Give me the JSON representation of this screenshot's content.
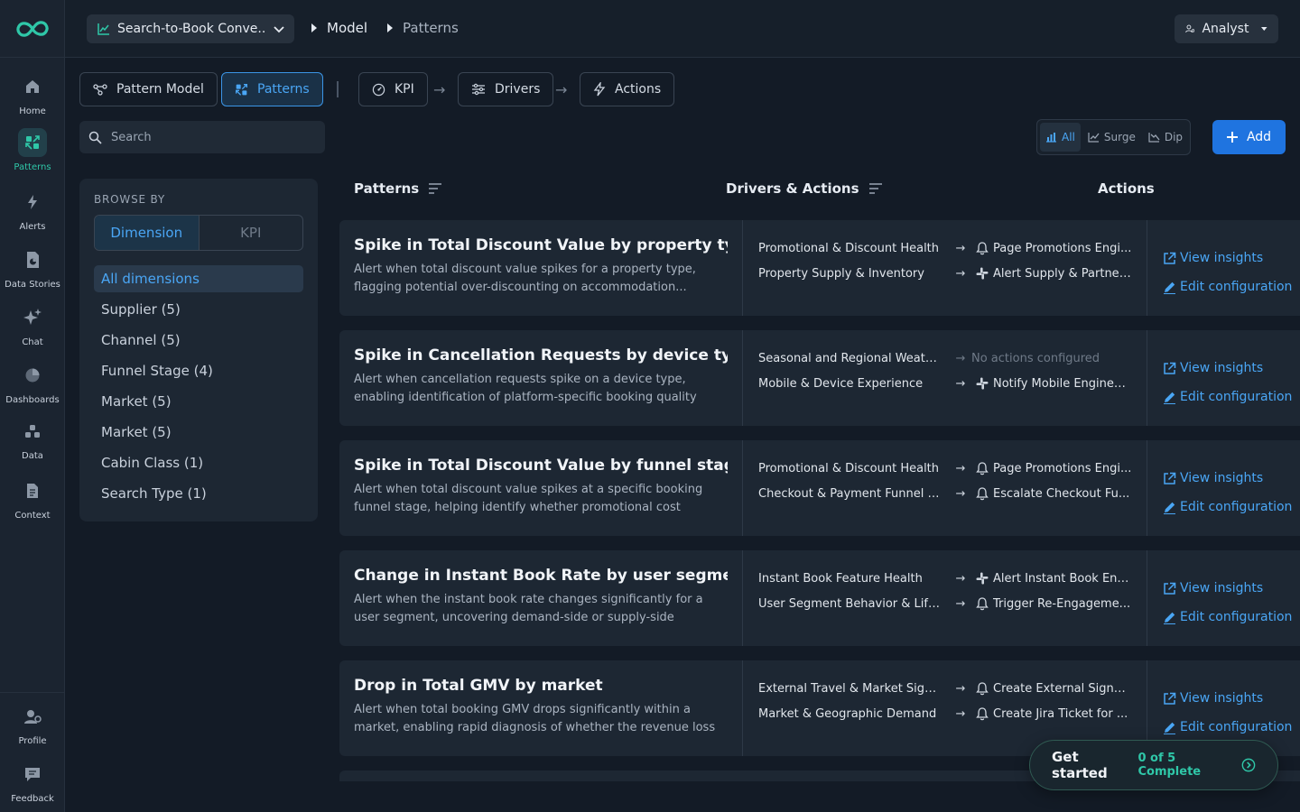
{
  "nav": {
    "items": [
      {
        "label": "Home",
        "icon": "home-icon"
      },
      {
        "label": "Patterns",
        "icon": "patterns-icon"
      },
      {
        "label": "Alerts",
        "icon": "bolt-icon"
      },
      {
        "label": "Data Stories",
        "icon": "data-stories-icon"
      },
      {
        "label": "Chat",
        "icon": "sparkle-icon"
      },
      {
        "label": "Dashboards",
        "icon": "pie-chart-icon"
      },
      {
        "label": "Data",
        "icon": "data-icon"
      },
      {
        "label": "Context",
        "icon": "document-icon"
      }
    ],
    "profile_label": "Profile",
    "feedback_label": "Feedback"
  },
  "header": {
    "model_select": "Search-to-Book Conve...",
    "breadcrumb": [
      "Model",
      "Patterns"
    ],
    "role": "Analyst"
  },
  "tabs": {
    "pattern_model": "Pattern Model",
    "patterns": "Patterns",
    "kpi": "KPI",
    "drivers": "Drivers",
    "actions": "Actions"
  },
  "search": {
    "placeholder": "Search"
  },
  "browse": {
    "title": "BROWSE BY",
    "toggle": [
      "Dimension",
      "KPI"
    ],
    "items": [
      "All dimensions",
      "Supplier (5)",
      "Channel (5)",
      "Funnel Stage (4)",
      "Market (5)",
      "Market (5)",
      "Cabin Class (1)",
      "Search Type (1)"
    ]
  },
  "filters": [
    "All",
    "Surge",
    "Dip"
  ],
  "add_label": "Add",
  "table": {
    "headers": [
      "Patterns",
      "Drivers & Actions",
      "Actions"
    ],
    "view_label": "View insights",
    "edit_label": "Edit configuration",
    "rows": [
      {
        "title": "Spike in Total Discount Value by property type",
        "desc": "Alert when total discount value spikes for a property type, flagging potential over-discounting on accommodation...",
        "drivers": [
          {
            "name": "Promotional & Discount Health",
            "icon": "bell-icon",
            "action": "Page Promotions Engi..."
          },
          {
            "name": "Property Supply & Inventory",
            "icon": "slack-icon",
            "action": "Alert Supply & Partner..."
          }
        ]
      },
      {
        "title": "Spike in Cancellation Requests by device type",
        "desc": "Alert when cancellation requests spike on a device type, enabling identification of platform-specific booking quality issues.",
        "drivers": [
          {
            "name": "Seasonal and Regional Weath...",
            "icon": "",
            "action": "No actions configured"
          },
          {
            "name": "Mobile & Device Experience",
            "icon": "slack-icon",
            "action": "Notify Mobile Enginee..."
          }
        ]
      },
      {
        "title": "Spike in Total Discount Value by funnel stage",
        "desc": "Alert when total discount value spikes at a specific booking funnel stage, helping identify whether promotional cost increases...",
        "drivers": [
          {
            "name": "Promotional & Discount Health",
            "icon": "bell-icon",
            "action": "Page Promotions Engi..."
          },
          {
            "name": "Checkout & Payment Funnel H...",
            "icon": "bell-icon",
            "action": "Escalate Checkout Fu..."
          }
        ]
      },
      {
        "title": "Change in Instant Book Rate by user segment",
        "desc": "Alert when the instant book rate changes significantly for a user segment, uncovering demand-side or supply-side mismatches...",
        "drivers": [
          {
            "name": "Instant Book Feature Health",
            "icon": "slack-icon",
            "action": "Alert Instant Book Eng..."
          },
          {
            "name": "User Segment Behavior & Life...",
            "icon": "bell-icon",
            "action": "Trigger Re-Engageme..."
          }
        ]
      },
      {
        "title": "Drop in Total GMV by market",
        "desc": "Alert when total booking GMV drops significantly within a market, enabling rapid diagnosis of whether the revenue loss stems fro...",
        "drivers": [
          {
            "name": "External Travel & Market Signals",
            "icon": "bell-icon",
            "action": "Create External Signal..."
          },
          {
            "name": "Market & Geographic Demand",
            "icon": "bell-icon",
            "action": "Create Jira Ticket for ..."
          }
        ]
      }
    ]
  },
  "get_started": {
    "title": "Get started",
    "progress": "0 of 5 Complete"
  },
  "colors": {
    "accent": "#4aa6f5",
    "brand": "#2fc7a8",
    "primary_button": "#1f74e0",
    "background": "#131b26"
  }
}
